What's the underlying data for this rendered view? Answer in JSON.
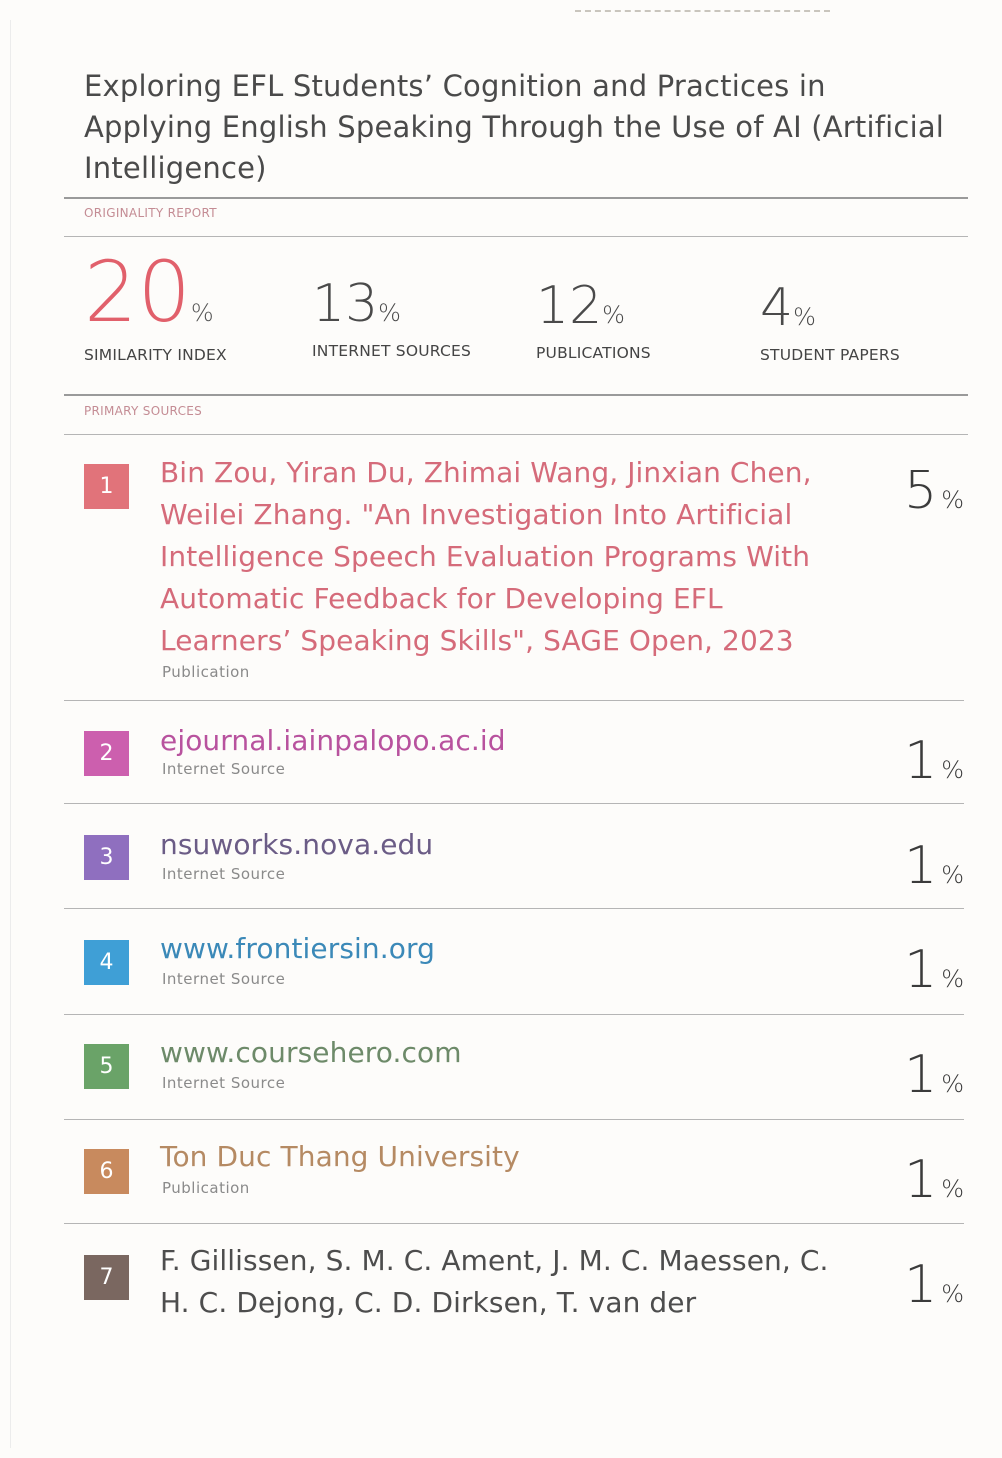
{
  "document": {
    "title": "Exploring EFL Students’ Cognition and Practices in Applying English Speaking Through the Use of AI (Artificial Intelligence)",
    "originality_label": "ORIGINALITY REPORT",
    "primary_sources_label": "PRIMARY SOURCES",
    "percent_sign": "%"
  },
  "stats": [
    {
      "value": "20",
      "caption": "SIMILARITY INDEX"
    },
    {
      "value": "13",
      "caption": "INTERNET SOURCES"
    },
    {
      "value": "12",
      "caption": "PUBLICATIONS"
    },
    {
      "value": "4",
      "caption": "STUDENT PAPERS"
    }
  ],
  "sources": [
    {
      "rank": "1",
      "title": "Bin Zou, Yiran Du, Zhimai Wang, Jinxian Chen, Weilei Zhang. \"An Investigation Into Artificial Intelligence Speech Evaluation Programs With Automatic Feedback for Developing EFL Learners’ Speaking Skills\", SAGE Open, 2023",
      "type": "Publication",
      "percent": "5",
      "color": "#e1737a",
      "title_color": "#d56b7a"
    },
    {
      "rank": "2",
      "title": "ejournal.iainpalopo.ac.id",
      "type": "Internet Source",
      "percent": "1",
      "color": "#cc5fae",
      "title_color": "#b8529e"
    },
    {
      "rank": "3",
      "title": "nsuworks.nova.edu",
      "type": "Internet Source",
      "percent": "1",
      "color": "#8f6fbf",
      "title_color": "#6b5c86"
    },
    {
      "rank": "4",
      "title": "www.frontiersin.org",
      "type": "Internet Source",
      "percent": "1",
      "color": "#3f9fd6",
      "title_color": "#3b89b8"
    },
    {
      "rank": "5",
      "title": "www.coursehero.com",
      "type": "Internet Source",
      "percent": "1",
      "color": "#6aa368",
      "title_color": "#6d8a69"
    },
    {
      "rank": "6",
      "title": "Ton Duc Thang University",
      "type": "Publication",
      "percent": "1",
      "color": "#c88a5e",
      "title_color": "#b58a63"
    },
    {
      "rank": "7",
      "title": "F. Gillissen, S. M. C. Ament, J. M. C. Maessen, C. H. C. Dejong, C. D. Dirksen, T. van der",
      "type": "",
      "percent": "1",
      "color": "#7a6760",
      "title_color": "#4d4d4d"
    }
  ]
}
